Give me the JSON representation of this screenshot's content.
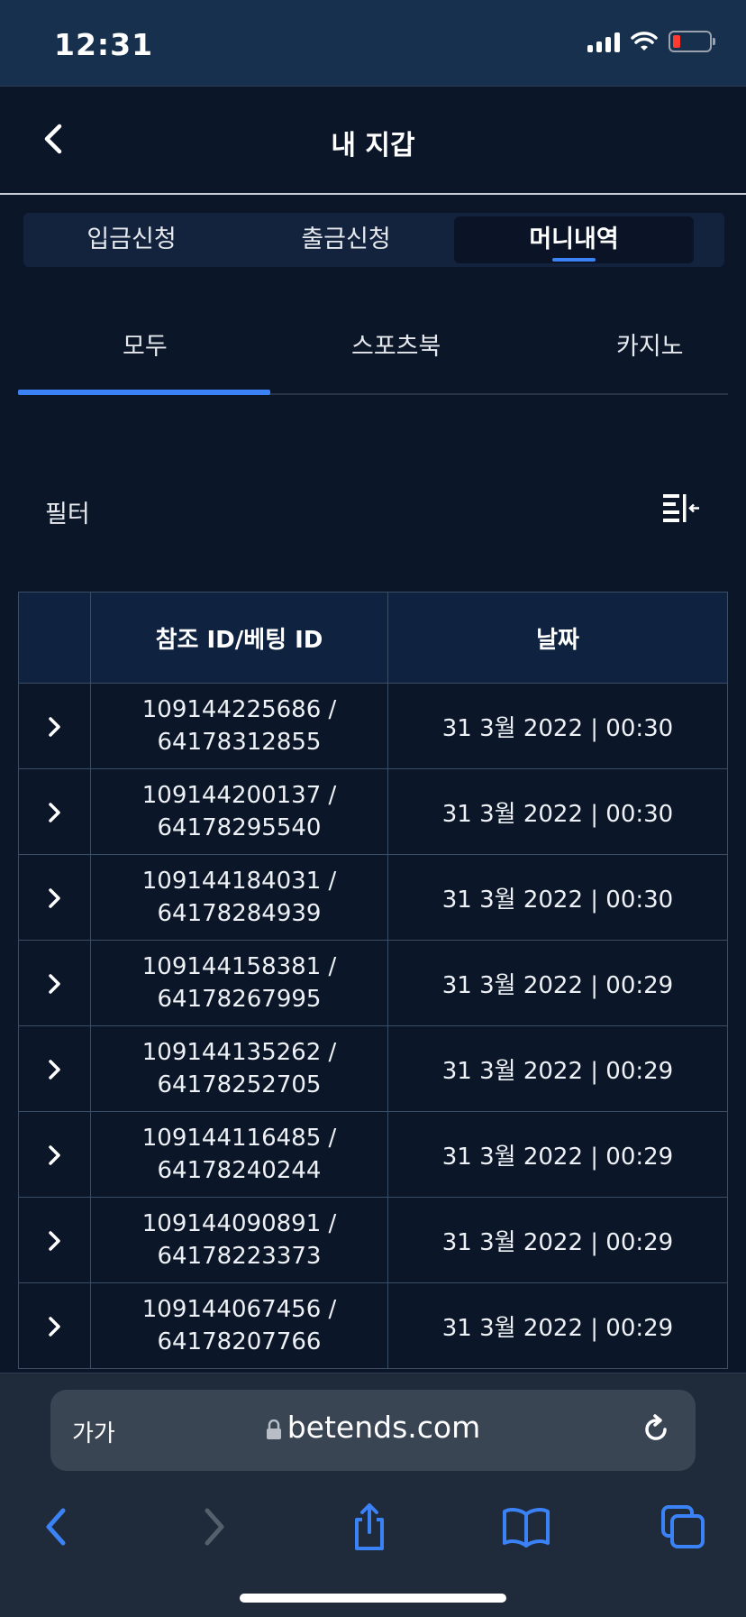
{
  "status": {
    "time": "12:31",
    "battery_color": "#ff3b30"
  },
  "header": {
    "title": "내 지갑"
  },
  "wallet_tabs": [
    {
      "label": "입금신청",
      "active": false
    },
    {
      "label": "출금신청",
      "active": false
    },
    {
      "label": "머니내역",
      "active": true
    }
  ],
  "sub_tabs": [
    {
      "label": "모두",
      "active": true
    },
    {
      "label": "스포츠북",
      "active": false
    },
    {
      "label": "카지노",
      "active": false
    }
  ],
  "filter": {
    "label": "필터",
    "icon": "filter-icon"
  },
  "table": {
    "headers": [
      "",
      "참조 ID/베팅 ID",
      "날짜"
    ],
    "rows": [
      {
        "ref_id": "109144225686 /",
        "bet_id": "64178312855",
        "date": "31 3월 2022 | 00:30"
      },
      {
        "ref_id": "109144200137 /",
        "bet_id": "64178295540",
        "date": "31 3월 2022 | 00:30"
      },
      {
        "ref_id": "109144184031 /",
        "bet_id": "64178284939",
        "date": "31 3월 2022 | 00:30"
      },
      {
        "ref_id": "109144158381 /",
        "bet_id": "64178267995",
        "date": "31 3월 2022 | 00:29"
      },
      {
        "ref_id": "109144135262 /",
        "bet_id": "64178252705",
        "date": "31 3월 2022 | 00:29"
      },
      {
        "ref_id": "109144116485 /",
        "bet_id": "64178240244",
        "date": "31 3월 2022 | 00:29"
      },
      {
        "ref_id": "109144090891 /",
        "bet_id": "64178223373",
        "date": "31 3월 2022 | 00:29"
      },
      {
        "ref_id": "109144067456 /",
        "bet_id": "64178207766",
        "date": "31 3월 2022 | 00:29"
      }
    ]
  },
  "browser": {
    "text_size_label": "가가",
    "url": "betends.com",
    "accent": "#3b82f6"
  }
}
